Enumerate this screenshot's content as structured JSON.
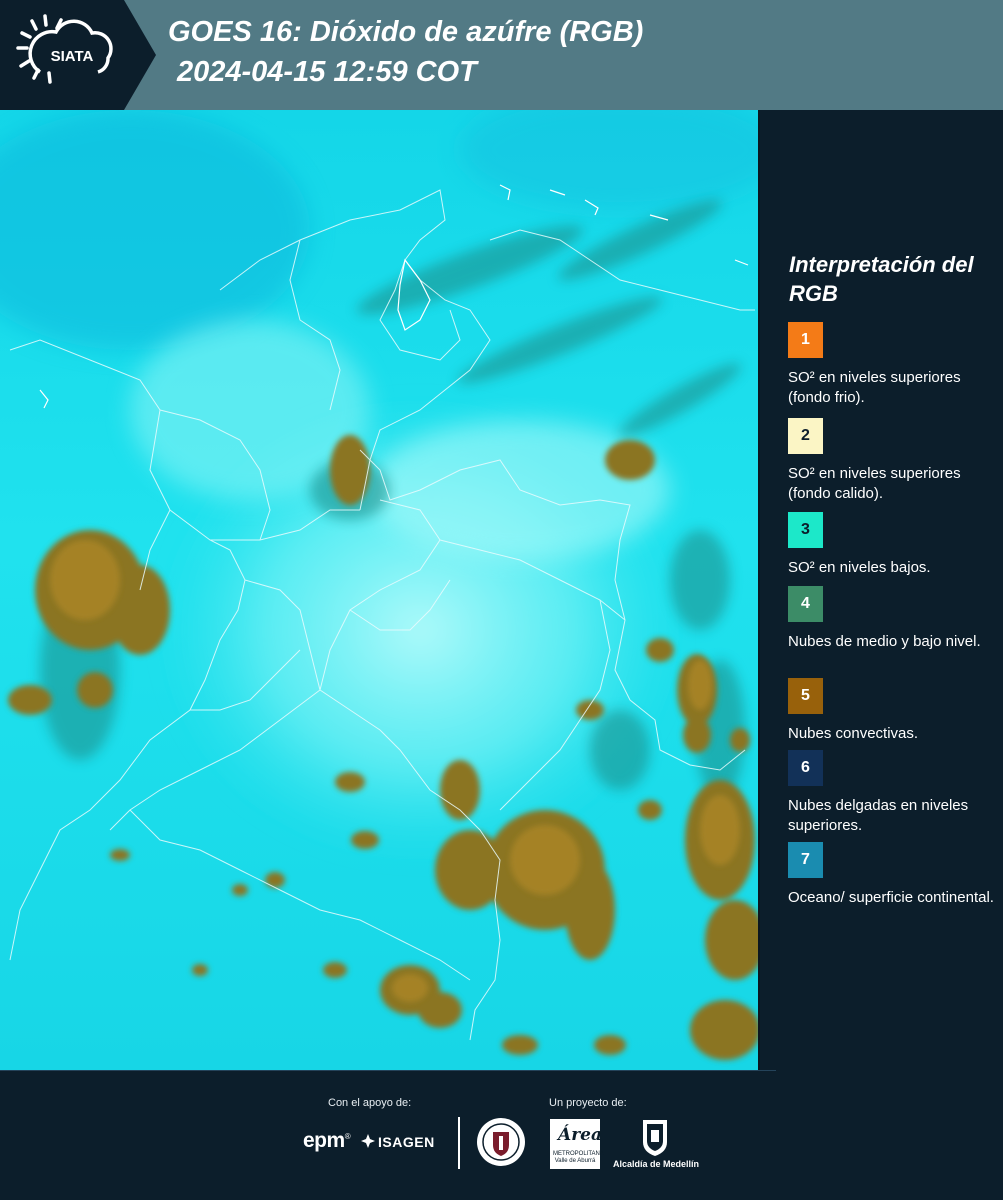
{
  "header": {
    "logo_text": "SIATA",
    "title": "GOES 16: Dióxido de azúfre (RGB)",
    "subtitle": " 2024-04-15 12:59 COT"
  },
  "legend": {
    "title": "Interpretación del RGB",
    "items": [
      {
        "number": "1",
        "color": "#f47b17",
        "text": "SO² en niveles superiores (fondo frio)."
      },
      {
        "number": "2",
        "color": "#fbf5c5",
        "text": "SO² en niveles superiores (fondo calido)."
      },
      {
        "number": "3",
        "color": "#1ce8c9",
        "text": "SO² en niveles bajos."
      },
      {
        "number": "4",
        "color": "#3c8c67",
        "text": "Nubes de medio y bajo nivel."
      },
      {
        "number": "5",
        "color": "#98610b",
        "text": "Nubes convectivas."
      },
      {
        "number": "6",
        "color": "#123158",
        "text": "Nubes delgadas en niveles superiores."
      },
      {
        "number": "7",
        "color": "#1a8cb0",
        "text": "Oceano/ superficie continental."
      }
    ]
  },
  "footer": {
    "support_label": "Con el apoyo de:",
    "project_label": "Un proyecto de:",
    "epm": "epm",
    "isagen": "ISAGEN",
    "area_logo": "Área",
    "area_sub": "METROPOLITANA Valle de Aburrá",
    "alcaldia": "Alcaldía de Medellín"
  }
}
